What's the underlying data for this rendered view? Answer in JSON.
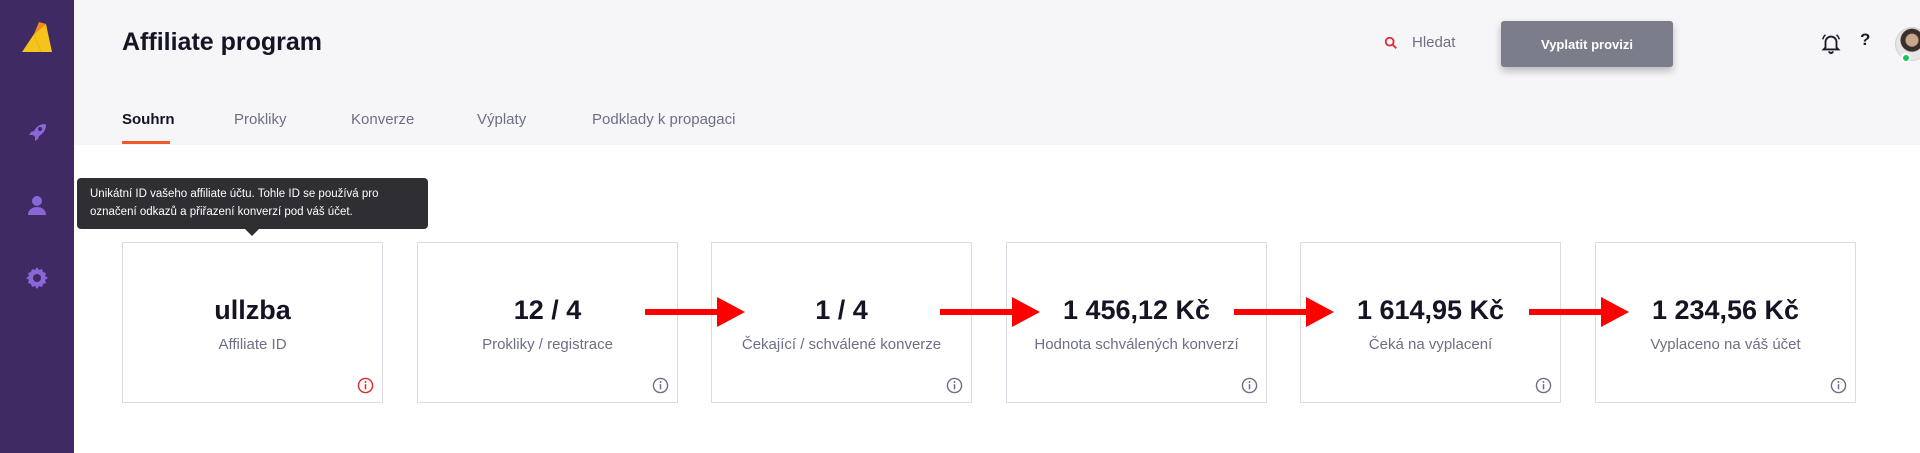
{
  "app": {
    "page_title": "Affiliate program",
    "search_label": "Hledat",
    "payout_button": "Vyplatit provizi",
    "help_label": "?"
  },
  "sidebar": {
    "items": [
      {
        "icon": "rocket-icon"
      },
      {
        "icon": "user-icon"
      },
      {
        "icon": "gear-icon"
      }
    ]
  },
  "tabs": [
    {
      "label": "Souhrn",
      "active": true
    },
    {
      "label": "Prokliky",
      "active": false
    },
    {
      "label": "Konverze",
      "active": false
    },
    {
      "label": "Výplaty",
      "active": false
    },
    {
      "label": "Podklady k propagaci",
      "active": false
    }
  ],
  "tooltip": {
    "line1": "Unikátní ID vašeho affiliate účtu. Tohle ID se používá pro",
    "line2": "označení odkazů a přiřazení konverzí pod váš účet."
  },
  "cards": [
    {
      "value": "ullzba",
      "label": "Affiliate ID"
    },
    {
      "value": "12 / 4",
      "label": "Prokliky / registrace"
    },
    {
      "value": "1 / 4",
      "label": "Čekající / schválené konverze"
    },
    {
      "value": "1 456,12 Kč",
      "label": "Hodnota schválených konverzí"
    },
    {
      "value": "1 614,95 Kč",
      "label": "Čeká na vyplacení"
    },
    {
      "value": "1 234,56 Kč",
      "label": "Vyplaceno na váš účet"
    }
  ],
  "colors": {
    "sidebar": "#3f2a64",
    "accent": "#ef5a2b",
    "button": "#7c7d8b",
    "arrow": "#ff0000",
    "info_active": "#e0262b",
    "info_default": "#6d6f84"
  }
}
